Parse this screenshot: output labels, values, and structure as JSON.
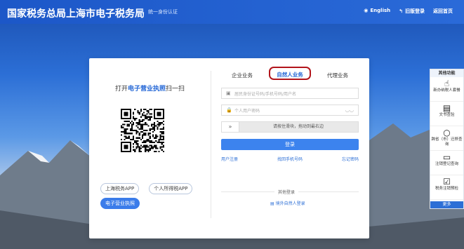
{
  "header": {
    "brand": "国家税务总局上海市电子税务局",
    "subtitle": "统一身份认证",
    "links": [
      {
        "icon": "globe-icon",
        "label": "English"
      },
      {
        "icon": "arrow-left-icon",
        "label": "旧版登录"
      },
      {
        "icon": "",
        "label": "返回首页"
      }
    ]
  },
  "left_panel": {
    "scan_prefix": "打开",
    "scan_highlight": "电子营业执照",
    "scan_suffix": "扫一扫",
    "buttons": [
      "上海税务APP",
      "个人所得税APP"
    ],
    "active_button": "电子营业执照"
  },
  "tabs": [
    {
      "label": "企业业务",
      "active": false
    },
    {
      "label": "自然人业务",
      "active": true
    },
    {
      "label": "代理业务",
      "active": false
    }
  ],
  "form": {
    "account_placeholder": "居民身份证号码/手机号码/用户名",
    "password_placeholder": "个人用户密码",
    "slider_text": "请按住滑块，拖动到最右边",
    "login_label": "登录",
    "links": [
      "用户注册",
      "找回手机号码",
      "忘记密码"
    ],
    "other_login_label": "其他登录",
    "foreign_login": "境外自然人登录"
  },
  "sidebar": {
    "title": "其他功能",
    "items": [
      {
        "icon": "hand-pointer-icon",
        "label": "新办纳税人套餐"
      },
      {
        "icon": "document-icon",
        "label": "文书查验"
      },
      {
        "icon": "search-icon",
        "label": "跨省（市）迁移查询"
      },
      {
        "icon": "register-icon",
        "label": "注销登记查询"
      },
      {
        "icon": "check-document-icon",
        "label": "税务注销预检"
      }
    ],
    "footer": "更多"
  }
}
